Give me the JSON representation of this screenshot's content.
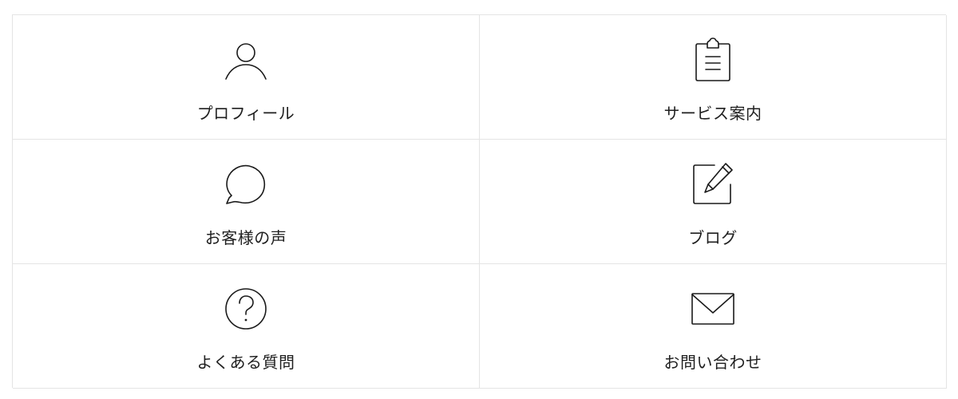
{
  "menu": {
    "items": [
      {
        "label": "プロフィール",
        "icon": "person-icon"
      },
      {
        "label": "サービス案内",
        "icon": "clipboard-icon"
      },
      {
        "label": "お客様の声",
        "icon": "speech-bubble-icon"
      },
      {
        "label": "ブログ",
        "icon": "edit-pencil-icon"
      },
      {
        "label": "よくある質問",
        "icon": "question-circle-icon"
      },
      {
        "label": "お問い合わせ",
        "icon": "envelope-icon"
      }
    ]
  },
  "colors": {
    "border": "#e4e4e4",
    "text": "#1f1f1f",
    "icon_stroke": "#1a1a1a",
    "background": "#ffffff"
  }
}
